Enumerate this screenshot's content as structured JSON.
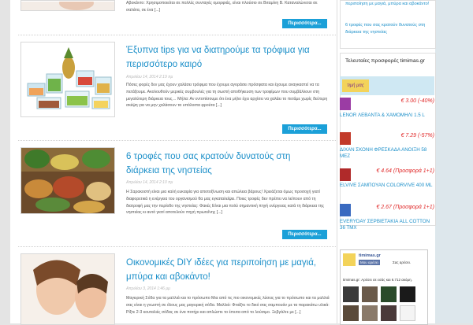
{
  "posts": [
    {
      "excerpt": "Αβοκάντο: Χρησιμοποιείται σε πολλές συνταγές ομορφιάς, είναι πλούσιο σε Βιταμίνη Β. Καταναλώνεται σε σαλάτα, σε ένα [...]",
      "more": "Περισσότερα..."
    },
    {
      "title": "Έξυπνα tips για να διατηρούμε τα τρόφιμα για περισσότερο καιρό",
      "date": "Απριλίου 14, 2014 2:19 πμ",
      "excerpt": "Πόσες φορές δεν μας έχουν χαλάσει τρόφιμα που έχουμε αγοράσει πρόσφατα και έχουμε αναγκαστεί να τα πετάξουμε. Ακολουθούν μερικές συμβουλές για τη σωστή αποθήκευση των τροφίμων που συμβάλλουν στη μεγαλύτερη διάρκεια τους… Μήλα: Αν εντοπίσουμε ότι ένα μήλο έχει αρχίσει να χαλάει το πετάμε χωρίς δεύτερη σκέψη για να μην χαλάσουν τα υπόλοιπα φρούτα [...]",
      "more": "Περισσότερα..."
    },
    {
      "title": "6 τροφές που σας κρατούν δυνατούς στη διάρκεια της νηστείας",
      "date": "Απριλίου 14, 2014 2:10 πμ",
      "excerpt": "Η Σαρακοστή είναι μια καλή ευκαιρία για αποτοξίνωση και απώλεια βάρους! Χρειάζεται όμως προσοχή γιατί διαφορετικά η ενέργεια του οργανισμού θα μας εγκαταλείψει. Ποιες τροφές δεν πρέπει να λείπουν από τη διατροφή μας την περίοδο της νηστείας: Φακές Είναι μια πολύ σημαντική πηγή ενέργειας κατά τη διάρκεια της νηστείας κι αυτό γιατί αποτελούν πηγή πρωτεΐνης [...]",
      "more": "Περισσότερα..."
    },
    {
      "title": "Οικονομικές DIY ιδέες για περιποίηση με μαγιά, μπύρα και αβοκάντο!",
      "date": "Απριλίου 3, 2014 1:46 μμ",
      "excerpt": "Μαγειρική Σόδα για τα μαλλιά και το πρόσωπο Μια από τις πιο οικονομικές λύσεις για το πρόσωπο και τα μαλλιά σας είναι η γνωστή σε όλους μας μαγειρική σόδα. Μαλλιά: Φτιάξτε το δικό σας σαμπουάν με τα παρακάτω υλικά: Ρίξτε 2-3 κουταλιές σόδας σε ένα ποτήρι και απλώστε το έπειτα από το λούσιμο. Ξεβγάλτε με [...]"
    }
  ],
  "sidebar": {
    "recent_links": [
      "περιποίηση με μαγιά, μπύρα και αβοκάντο!",
      "6 τροφές που σας κρατούν δυνατούς στη διάρκεια της νηστείας"
    ],
    "offers_title": "Τελευταίες προσφορές timimas.gr",
    "offers": [
      {
        "price": "€ 3.00 (-40%)",
        "name": "LENOR ΛΕΒΑΝΤΑ & ΧΑΜΟΜΗΛΙ 1.5 L"
      },
      {
        "price": "€ 7.29 (-57%)",
        "name": "ΔΙΧΑΝ ΣΚΟΝΗ ΦΡΕΣΚΑΔΑ ΑΝΟΙΞΗ 58 ΜΕΖ"
      },
      {
        "price": "€ 4.64 (Προσφορά 1+1)",
        "name": "ELVIVE ΣΑΜΠΟΥΑΝ COLORVIVE 400 ML"
      },
      {
        "price": "€ 2.67 (Προσφορά 1+1)",
        "name": "EVERYDAY ΣΕΡΒΙΕΤΑΚΙΑ ALL COTTON 36 TMX"
      }
    ],
    "banner_text": "τιμή μας",
    "fb": {
      "page_name": "timimas.gr",
      "like_label": "Μου αρέσει",
      "friends_like": "Σας αρέσει.",
      "count_text": "timimas.gr: Αρέσει σε εσάς και 6.712 ακόμη."
    }
  },
  "colors": {
    "accent": "#1ba0d8",
    "link": "#1b8fc9",
    "price": "#e02828"
  }
}
